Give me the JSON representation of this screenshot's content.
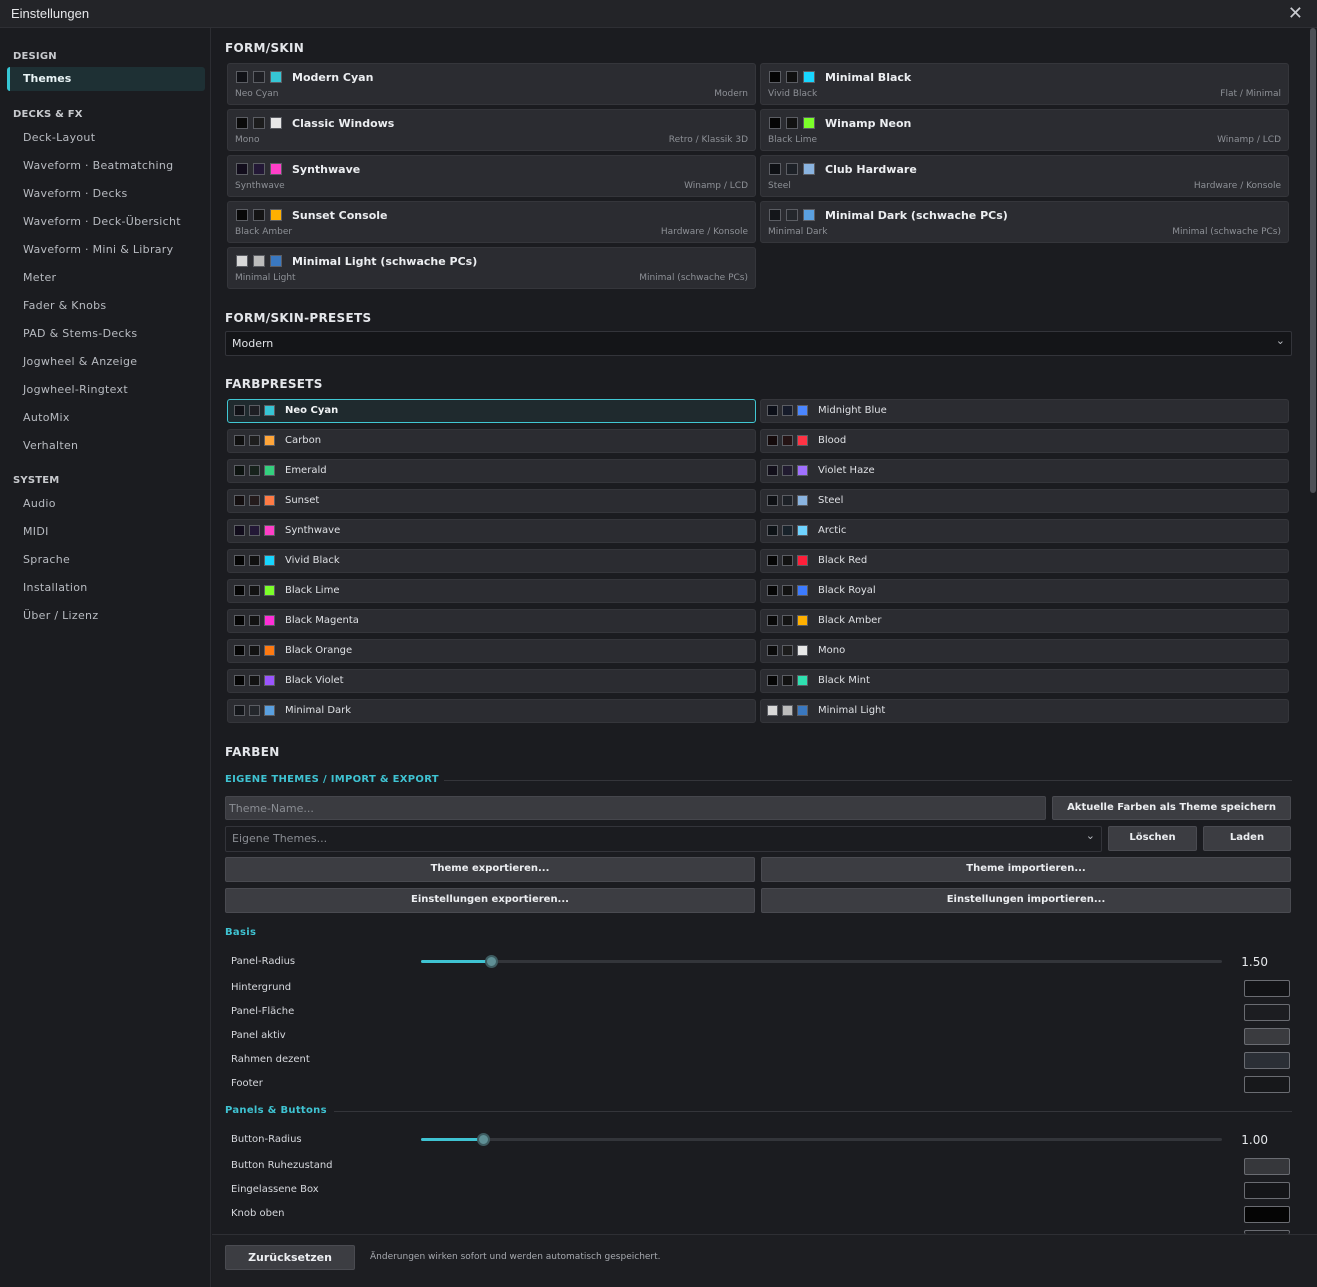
{
  "window": {
    "title": "Einstellungen"
  },
  "sidebar": {
    "groups": [
      {
        "label": "DESIGN",
        "items": [
          "Themes"
        ]
      },
      {
        "label": "DECKS & FX",
        "items": [
          "Deck-Layout",
          "Waveform · Beatmatching",
          "Waveform · Decks",
          "Waveform · Deck-Übersicht",
          "Waveform · Mini & Library",
          "Meter",
          "Fader & Knobs",
          "PAD & Stems-Decks",
          "Jogwheel & Anzeige",
          "Jogwheel-Ringtext",
          "AutoMix",
          "Verhalten"
        ]
      },
      {
        "label": "SYSTEM",
        "items": [
          "Audio",
          "MIDI",
          "Sprache",
          "Installation",
          "Über / Lizenz"
        ]
      }
    ],
    "active": "Themes"
  },
  "skins_heading": "FORM/SKIN",
  "skins": [
    {
      "name": "Modern Cyan",
      "sub": "Neo Cyan",
      "tag": "Modern",
      "colors": [
        "#111217",
        "#1e1f24",
        "#36c6d5"
      ]
    },
    {
      "name": "Minimal Black",
      "sub": "Vivid Black",
      "tag": "Flat / Minimal",
      "colors": [
        "#050505",
        "#101010",
        "#18d6ff"
      ]
    },
    {
      "name": "Classic Windows",
      "sub": "Mono",
      "tag": "Retro / Klassik 3D",
      "colors": [
        "#0a0a0a",
        "#1c1c1c",
        "#e8e8e8"
      ]
    },
    {
      "name": "Winamp Neon",
      "sub": "Black Lime",
      "tag": "Winamp / LCD",
      "colors": [
        "#050505",
        "#121212",
        "#7cff2a"
      ]
    },
    {
      "name": "Synthwave",
      "sub": "Synthwave",
      "tag": "Winamp / LCD",
      "colors": [
        "#120d1c",
        "#231836",
        "#ff3fc8"
      ]
    },
    {
      "name": "Club Hardware",
      "sub": "Steel",
      "tag": "Hardware / Konsole",
      "colors": [
        "#0e1014",
        "#1d2127",
        "#8ab4e0"
      ]
    },
    {
      "name": "Sunset Console",
      "sub": "Black Amber",
      "tag": "Hardware / Konsole",
      "colors": [
        "#080808",
        "#141414",
        "#ffb000"
      ]
    },
    {
      "name": "Minimal Dark (schwache PCs)",
      "sub": "Minimal Dark",
      "tag": "Minimal (schwache PCs)",
      "colors": [
        "#14161a",
        "#24272c",
        "#5aa0e0"
      ]
    },
    {
      "name": "Minimal Light (schwache PCs)",
      "sub": "Minimal Light",
      "tag": "Minimal (schwache PCs)",
      "colors": [
        "#d8d8d8",
        "#bcbcbc",
        "#3a78c0"
      ]
    }
  ],
  "skin_presets": {
    "heading": "FORM/SKIN-PRESETS",
    "selected": "Modern"
  },
  "color_presets": {
    "heading": "FARBPRESETS",
    "active": "Neo Cyan",
    "left": [
      {
        "name": "Neo Cyan",
        "colors": [
          "#111217",
          "#1e1f24",
          "#36c6d5"
        ]
      },
      {
        "name": "Carbon",
        "colors": [
          "#101010",
          "#1e1e1e",
          "#ffa53a"
        ]
      },
      {
        "name": "Emerald",
        "colors": [
          "#0d1310",
          "#17221c",
          "#34d07f"
        ]
      },
      {
        "name": "Sunset",
        "colors": [
          "#140f10",
          "#241b1c",
          "#ff7b45"
        ]
      },
      {
        "name": "Synthwave",
        "colors": [
          "#120d1c",
          "#231836",
          "#ff3fc8"
        ]
      },
      {
        "name": "Vivid Black",
        "colors": [
          "#050505",
          "#101010",
          "#18d6ff"
        ]
      },
      {
        "name": "Black Lime",
        "colors": [
          "#050505",
          "#121212",
          "#7cff2a"
        ]
      },
      {
        "name": "Black Magenta",
        "colors": [
          "#050505",
          "#121212",
          "#ff2fd8"
        ]
      },
      {
        "name": "Black Orange",
        "colors": [
          "#050505",
          "#121212",
          "#ff7a12"
        ]
      },
      {
        "name": "Black Violet",
        "colors": [
          "#050505",
          "#121212",
          "#9b55ff"
        ]
      },
      {
        "name": "Minimal Dark",
        "colors": [
          "#14161a",
          "#24272c",
          "#5aa0e0"
        ]
      }
    ],
    "right": [
      {
        "name": "Midnight Blue",
        "colors": [
          "#0c0f18",
          "#161b2a",
          "#4b86ff"
        ]
      },
      {
        "name": "Blood",
        "colors": [
          "#140a0b",
          "#241314",
          "#ff3344"
        ]
      },
      {
        "name": "Violet Haze",
        "colors": [
          "#120f1a",
          "#211b30",
          "#a070ff"
        ]
      },
      {
        "name": "Steel",
        "colors": [
          "#0e1014",
          "#1d2127",
          "#8ab4e0"
        ]
      },
      {
        "name": "Arctic",
        "colors": [
          "#0d1216",
          "#18222a",
          "#6fd3ff"
        ]
      },
      {
        "name": "Black Red",
        "colors": [
          "#050505",
          "#121212",
          "#ff1f3a"
        ]
      },
      {
        "name": "Black Royal",
        "colors": [
          "#050505",
          "#121212",
          "#3c7bff"
        ]
      },
      {
        "name": "Black Amber",
        "colors": [
          "#080808",
          "#141414",
          "#ffb000"
        ]
      },
      {
        "name": "Mono",
        "colors": [
          "#0a0a0a",
          "#1c1c1c",
          "#e8e8e8"
        ]
      },
      {
        "name": "Black Mint",
        "colors": [
          "#050505",
          "#121212",
          "#2fe0b0"
        ]
      },
      {
        "name": "Minimal Light",
        "colors": [
          "#d8d8d8",
          "#bcbcbc",
          "#3a78c0"
        ]
      }
    ]
  },
  "farben": {
    "heading": "FARBEN",
    "themes_heading": "EIGENE THEMES / IMPORT & EXPORT",
    "name_placeholder": "Theme-Name...",
    "save_label": "Aktuelle Farben als Theme speichern",
    "own_themes_placeholder": "Eigene Themes...",
    "delete_label": "Löschen",
    "load_label": "Laden",
    "export_theme_label": "Theme exportieren...",
    "import_theme_label": "Theme importieren...",
    "export_settings_label": "Einstellungen exportieren...",
    "import_settings_label": "Einstellungen importieren..."
  },
  "basis": {
    "heading": "Basis",
    "panel_radius": {
      "label": "Panel-Radius",
      "value": "1.50",
      "fraction": 0.087
    },
    "colors": [
      {
        "label": "Hintergrund",
        "color": "#121316"
      },
      {
        "label": "Panel-Fläche",
        "color": "#1c1d21"
      },
      {
        "label": "Panel aktiv",
        "color": "#3a3b3f"
      },
      {
        "label": "Rahmen dezent",
        "color": "#2b2f36"
      },
      {
        "label": "Footer",
        "color": "#17181b"
      }
    ]
  },
  "panels_buttons": {
    "heading": "Panels & Buttons",
    "button_radius": {
      "label": "Button-Radius",
      "value": "1.00",
      "fraction": 0.077
    },
    "colors": [
      {
        "label": "Button Ruhezustand",
        "color": "#36373b"
      },
      {
        "label": "Eingelassene Box",
        "color": "#141518"
      },
      {
        "label": "Knob oben",
        "color": "#050505"
      }
    ]
  },
  "footer": {
    "reset_label": "Zurücksetzen",
    "note": "Änderungen wirken sofort und werden automatisch gespeichert."
  }
}
